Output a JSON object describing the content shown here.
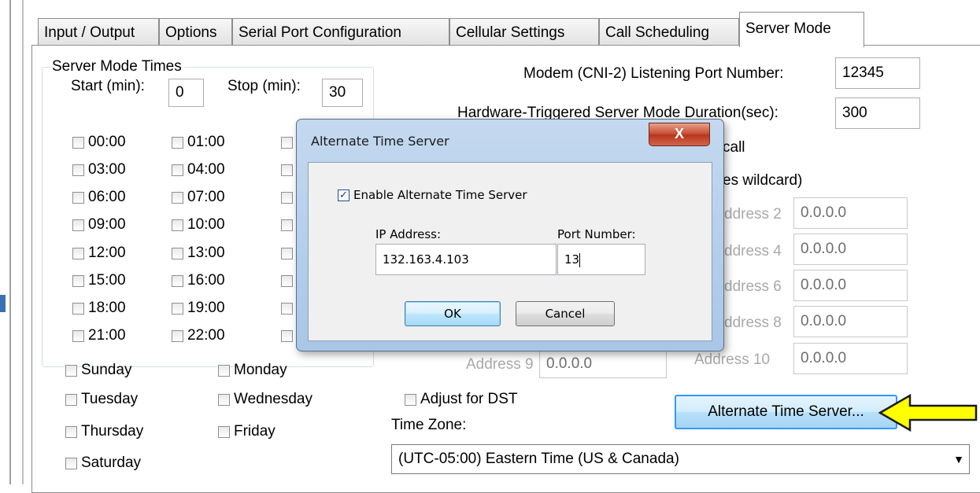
{
  "tabs": [
    "Input / Output",
    "Options",
    "Serial Port Configuration",
    "Cellular Settings",
    "Call Scheduling",
    "Server Mode"
  ],
  "server_times": {
    "legend": "Server Mode Times",
    "start_label": "Start (min):",
    "start_value": "0",
    "stop_label": "Stop (min):",
    "stop_value": "30",
    "col1": [
      "00:00",
      "03:00",
      "06:00",
      "09:00",
      "12:00",
      "15:00",
      "18:00",
      "21:00"
    ],
    "col2": [
      "01:00",
      "04:00",
      "07:00",
      "10:00",
      "13:00",
      "16:00",
      "19:00",
      "22:00"
    ]
  },
  "days": {
    "sunday": "Sunday",
    "monday": "Monday",
    "tuesday": "Tuesday",
    "wednesday": "Wednesday",
    "thursday": "Thursday",
    "friday": "Friday",
    "saturday": "Saturday"
  },
  "right": {
    "listen_label": "Modem (CNI-2) Listening Port Number:",
    "listen_value": "12345",
    "hw_label": "Hardware-Triggered Server Mode Duration(sec):",
    "hw_value": "300",
    "call_partial": "call",
    "wildcard_partial": "es wildcard)",
    "addr2_label": "ddress 2",
    "addr2_value": "0.0.0.0",
    "addr4_label": "ddress 4",
    "addr4_value": "0.0.0.0",
    "addr6_label": "ddress 6",
    "addr6_value": "0.0.0.0",
    "addr8_label": "ddress 8",
    "addr8_value": "0.0.0.0",
    "addr9_label": "Address 9",
    "addr9_value": "0.0.0.0",
    "addr10_label": "Address 10",
    "addr10_value": "0.0.0.0",
    "dst_label": "Adjust for DST",
    "tz_label": "Time Zone:",
    "tz_value": "(UTC-05:00) Eastern Time (US & Canada)",
    "alt_button": "Alternate Time Server..."
  },
  "dialog": {
    "title": "Alternate Time Server",
    "close": "X",
    "enable_label": "Enable Alternate Time Server",
    "ip_label": "IP Address:",
    "ip_value": "132.163.4.103",
    "port_label": "Port Number:",
    "port_value": "13",
    "ok": "OK",
    "cancel": "Cancel"
  },
  "colors": {
    "arrow_fill": "#ffff00",
    "arrow_stroke": "#1a1a1a",
    "alt_button_border": "#3399ff"
  }
}
